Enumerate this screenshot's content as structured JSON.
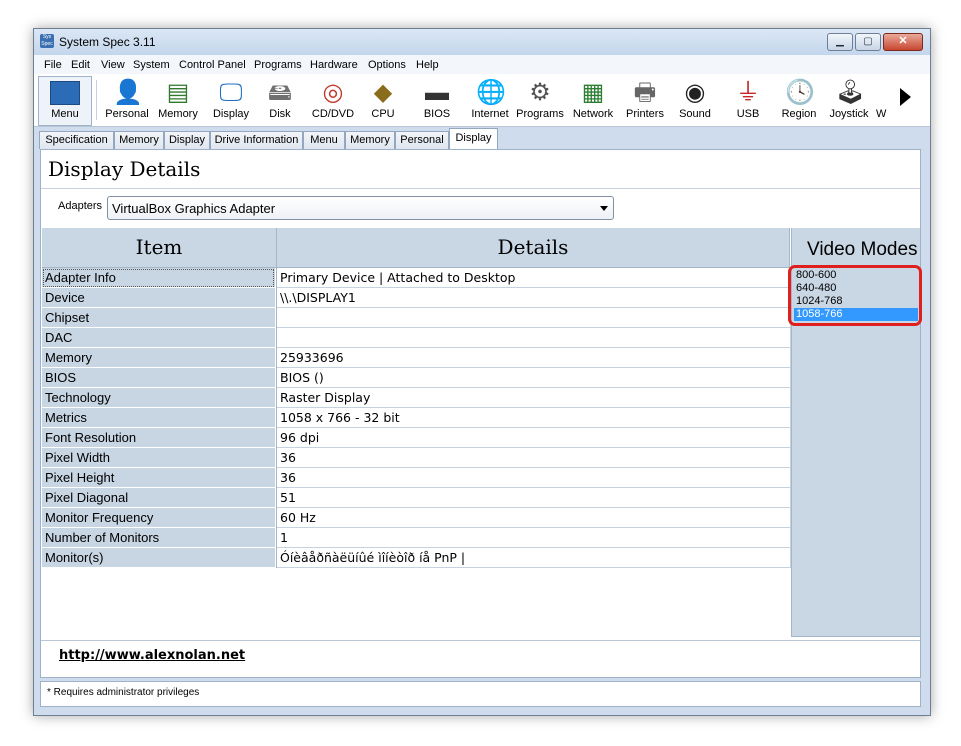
{
  "window": {
    "title": "System Spec 3.11",
    "app_icon_text": "Sys Spec",
    "controls": {
      "minimize": "▁",
      "maximize": "▢",
      "close": "✕"
    }
  },
  "menubar": [
    "File",
    "Edit",
    "View",
    "System",
    "Control Panel",
    "Programs",
    "Hardware",
    "Options",
    "Help"
  ],
  "toolbar": {
    "menu_label": "Menu",
    "items": [
      {
        "label": "Personal",
        "icon": "person-icon",
        "glyph": "👤",
        "color": "#2b7bd6"
      },
      {
        "label": "Memory",
        "icon": "memory-icon",
        "glyph": "▤",
        "color": "#2f7a2f"
      },
      {
        "label": "Display",
        "icon": "monitor-icon",
        "glyph": "🖵",
        "color": "#1f6fc4"
      },
      {
        "label": "Disk",
        "icon": "disk-icon",
        "glyph": "🖴",
        "color": "#707070"
      },
      {
        "label": "CD/DVD",
        "icon": "cd-icon",
        "glyph": "◎",
        "color": "#c0392b"
      },
      {
        "label": "CPU",
        "icon": "cpu-icon",
        "glyph": "◆",
        "color": "#8a6d1c"
      },
      {
        "label": "BIOS",
        "icon": "chip-icon",
        "glyph": "▬",
        "color": "#333333"
      },
      {
        "label": "Internet",
        "icon": "globe-icon",
        "glyph": "🌐",
        "color": "#1e88e5"
      },
      {
        "label": "Programs",
        "icon": "gear-icon",
        "glyph": "⚙",
        "color": "#555555"
      },
      {
        "label": "Network",
        "icon": "network-card-icon",
        "glyph": "▦",
        "color": "#2e7d32"
      },
      {
        "label": "Printers",
        "icon": "printer-icon",
        "glyph": "🖶",
        "color": "#666666"
      },
      {
        "label": "Sound",
        "icon": "speaker-icon",
        "glyph": "◉",
        "color": "#222222"
      },
      {
        "label": "USB",
        "icon": "usb-icon",
        "glyph": "⏚",
        "color": "#c62828"
      },
      {
        "label": "Region",
        "icon": "clock-icon",
        "glyph": "🕓",
        "color": "#555555"
      },
      {
        "label": "Joystick",
        "icon": "joystick-icon",
        "glyph": "🕹",
        "color": "#333333"
      },
      {
        "label": "W",
        "icon": "partial-icon",
        "glyph": "",
        "color": "#333333"
      }
    ]
  },
  "tabs": [
    "Specification",
    "Memory",
    "Display",
    "Drive Information",
    "Menu",
    "Memory",
    "Personal",
    "Display"
  ],
  "active_tab_index": 7,
  "page": {
    "title": "Display Details",
    "adapters_label": "Adapters",
    "adapter_value": "VirtualBox Graphics Adapter"
  },
  "table": {
    "headers": {
      "item": "Item",
      "details": "Details"
    },
    "rows": [
      {
        "item": "Adapter Info",
        "details": "Primary Device | Attached to Desktop"
      },
      {
        "item": "Device",
        "details": "\\\\.\\DISPLAY1"
      },
      {
        "item": "Chipset",
        "details": ""
      },
      {
        "item": "DAC",
        "details": ""
      },
      {
        "item": "Memory",
        "details": "25933696"
      },
      {
        "item": "BIOS",
        "details": "BIOS  ()"
      },
      {
        "item": "Technology",
        "details": "Raster Display"
      },
      {
        "item": "Metrics",
        "details": "1058 x 766 - 32 bit"
      },
      {
        "item": "Font Resolution",
        "details": "96 dpi"
      },
      {
        "item": "Pixel Width",
        "details": "36"
      },
      {
        "item": "Pixel Height",
        "details": "36"
      },
      {
        "item": "Pixel Diagonal",
        "details": "51"
      },
      {
        "item": "Monitor Frequency",
        "details": "60 Hz"
      },
      {
        "item": "Number of Monitors",
        "details": "1"
      },
      {
        "item": "Monitor(s)",
        "details": "Óíèâåðñàëüíûé ìîíèòîð íå PnP |"
      }
    ]
  },
  "video_modes": {
    "title": "Video Modes",
    "items": [
      "800-600",
      "640-480",
      "1024-768",
      "1058-766"
    ],
    "selected_index": 3
  },
  "footer": {
    "link": "http://www.alexnolan.net",
    "status": "* Requires administrator privileges"
  }
}
